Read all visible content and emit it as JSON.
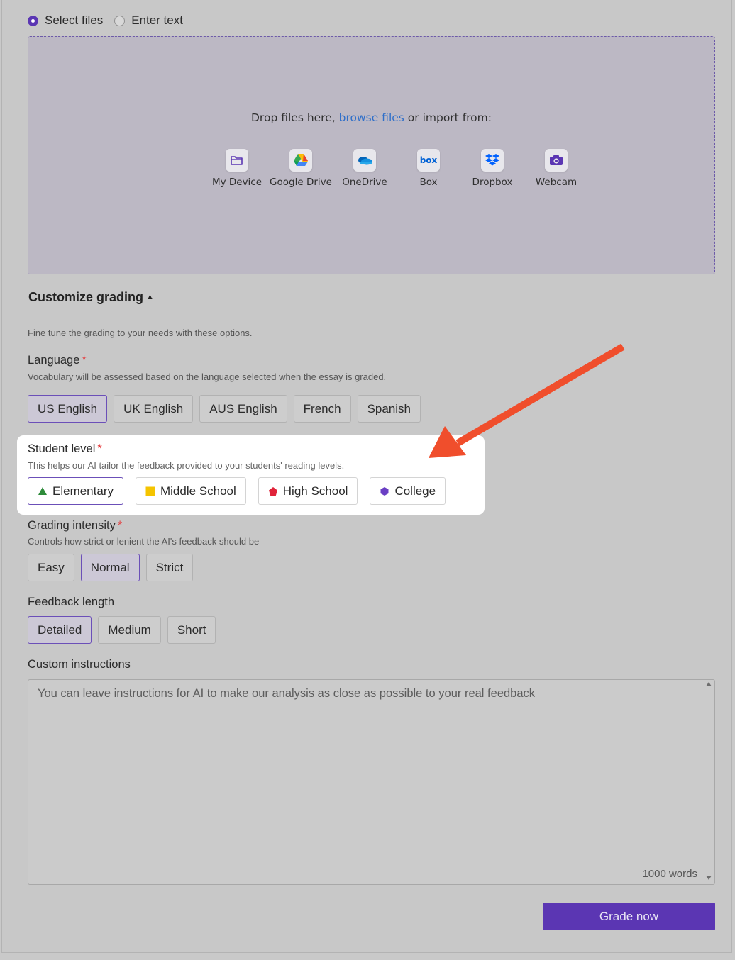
{
  "input_mode": {
    "options": [
      {
        "label": "Select files",
        "selected": true
      },
      {
        "label": "Enter text",
        "selected": false
      }
    ]
  },
  "dropzone": {
    "text_before": "Drop files here, ",
    "link": "browse files",
    "text_after": " or import from:",
    "sources": [
      {
        "label": "My Device",
        "icon": "folder-icon"
      },
      {
        "label": "Google Drive",
        "icon": "google-drive-icon"
      },
      {
        "label": "OneDrive",
        "icon": "onedrive-icon"
      },
      {
        "label": "Box",
        "icon": "box-icon"
      },
      {
        "label": "Dropbox",
        "icon": "dropbox-icon"
      },
      {
        "label": "Webcam",
        "icon": "camera-icon"
      }
    ]
  },
  "customize": {
    "title": "Customize grading",
    "description": "Fine tune the grading to your needs with these options."
  },
  "language": {
    "label": "Language",
    "required_mark": "*",
    "help": "Vocabulary will be assessed based on the language selected when the essay is graded.",
    "options": [
      "US English",
      "UK English",
      "AUS English",
      "French",
      "Spanish"
    ],
    "selected": "US English"
  },
  "student_level": {
    "label": "Student level",
    "required_mark": "*",
    "help": "This helps our AI tailor the feedback provided to your students' reading levels.",
    "options": [
      {
        "label": "Elementary",
        "icon": "triangle-icon",
        "color": "#2e8b3a"
      },
      {
        "label": "Middle School",
        "icon": "square-icon",
        "color": "#f5c400"
      },
      {
        "label": "High School",
        "icon": "pentagon-icon",
        "color": "#e0233a"
      },
      {
        "label": "College",
        "icon": "hexagon-icon",
        "color": "#6a3fc4"
      }
    ],
    "selected": "Elementary"
  },
  "grading_intensity": {
    "label": "Grading intensity",
    "required_mark": "*",
    "help": "Controls how strict or lenient the AI's feedback should be",
    "options": [
      "Easy",
      "Normal",
      "Strict"
    ],
    "selected": "Normal"
  },
  "feedback_length": {
    "label": "Feedback length",
    "options": [
      "Detailed",
      "Medium",
      "Short"
    ],
    "selected": "Detailed"
  },
  "custom_instructions": {
    "label": "Custom instructions",
    "placeholder": "You can leave instructions for AI to make our analysis as close as possible to your real feedback",
    "word_count": "1000 words"
  },
  "submit": {
    "label": "Grade now"
  },
  "colors": {
    "accent": "#5b36b3",
    "annotation_arrow": "#f04e2c",
    "required": "#e5393b",
    "link": "#2f6fc9"
  }
}
